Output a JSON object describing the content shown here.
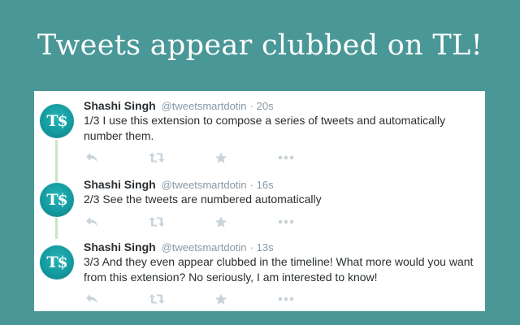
{
  "headline": "Tweets appear clubbed on TL!",
  "avatar_text": "T$",
  "colors": {
    "background": "#4a9797",
    "avatar": "#149ba0",
    "thread_line": "#c8e6c0",
    "icon": "#c9d3da"
  },
  "action_icons": [
    "reply-icon",
    "retweet-icon",
    "favorite-icon",
    "more-icon"
  ],
  "tweets": [
    {
      "name": "Shashi Singh",
      "handle": "@tweetsmartdotin",
      "separator": "·",
      "time": "20s",
      "text": "1/3 I use this extension to compose a series of tweets and automatically number them."
    },
    {
      "name": "Shashi Singh",
      "handle": "@tweetsmartdotin",
      "separator": "·",
      "time": "16s",
      "text": "2/3 See the tweets are numbered automatically"
    },
    {
      "name": "Shashi Singh",
      "handle": "@tweetsmartdotin",
      "separator": "·",
      "time": "13s",
      "text": "3/3 And they even appear clubbed in the timeline! What more would you want from this extension? No seriously, I am interested to know!"
    }
  ]
}
